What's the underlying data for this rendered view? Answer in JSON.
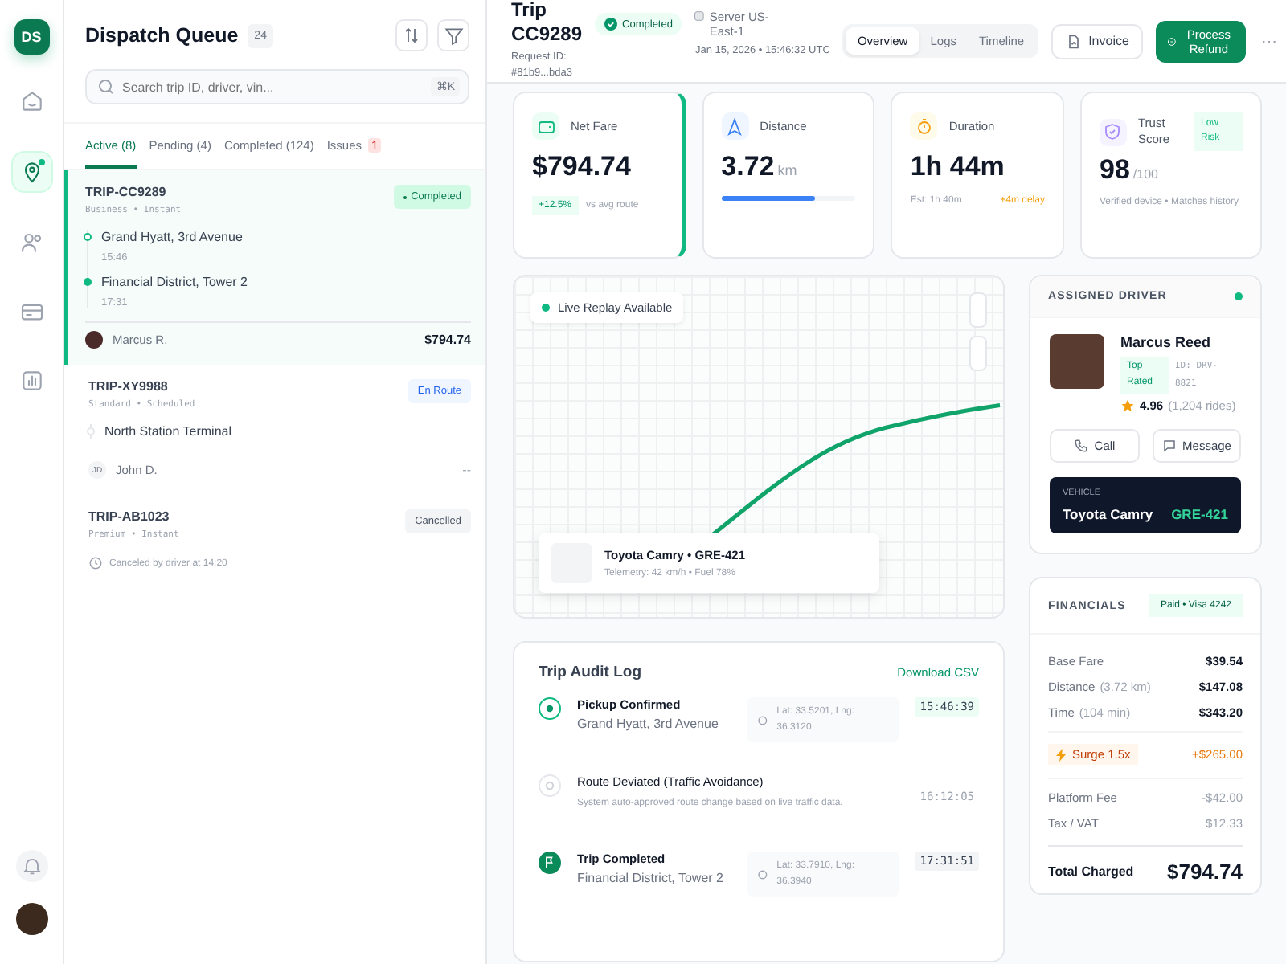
{
  "rail": {
    "logo": "DS",
    "items": [
      {
        "kind": "home",
        "selected": false
      },
      {
        "kind": "pin",
        "selected": true,
        "dot": true
      },
      {
        "kind": "users",
        "selected": false
      },
      {
        "kind": "card",
        "selected": false
      },
      {
        "kind": "chart",
        "selected": false
      }
    ]
  },
  "queue": {
    "title": "Dispatch Queue",
    "count": "24",
    "search": {
      "placeholder": "Search trip ID, driver, vin...",
      "shortcut": "⌘K"
    },
    "tabs": [
      {
        "label": "Active (8)",
        "selected": true
      },
      {
        "label": "Pending (4)",
        "selected": false
      },
      {
        "label": "Completed (124)",
        "selected": false
      },
      {
        "label": "Issues",
        "selected": false,
        "badge": "1"
      }
    ],
    "trips": [
      {
        "id": "TRIP-CC9289",
        "meta": "Business • Instant",
        "status": "Completed",
        "kind": "completed",
        "selected": true,
        "stops": [
          {
            "name": "Grand Hyatt, 3rd Avenue",
            "time": "15:46",
            "kind": "pickup"
          },
          {
            "name": "Financial District, Tower 2",
            "time": "17:31",
            "kind": "dropoff"
          }
        ],
        "driver": {
          "name": "Marcus R."
        },
        "fare": "$794.74"
      },
      {
        "id": "TRIP-XY9988",
        "meta": "Standard • Scheduled",
        "status": "En Route",
        "kind": "en_route",
        "selected": false,
        "stops": [
          {
            "name": "North Station Terminal",
            "kind": "pending"
          }
        ],
        "driver": {
          "name": "John D.",
          "initials": "JD"
        },
        "fare": "--"
      },
      {
        "id": "TRIP-AB1023",
        "meta": "Premium • Instant",
        "status": "Cancelled",
        "kind": "cancelled",
        "selected": false,
        "note": "Canceled by driver at 14:20"
      }
    ]
  },
  "header": {
    "title_prefix": "Trip",
    "title": "CC9289",
    "status": "Completed",
    "request_label": "Request ID:",
    "request_id": "#81b9...bda3",
    "server_label": "Server",
    "server": "US-East-1",
    "timestamp": "Jan 15, 2026 • 15:46:32 UTC",
    "view_tabs": [
      {
        "label": "Overview",
        "selected": true
      },
      {
        "label": "Logs",
        "selected": false
      },
      {
        "label": "Timeline",
        "selected": false
      }
    ],
    "invoice": "Invoice",
    "refund": "Process Refund",
    "more": "⋯"
  },
  "metrics": [
    {
      "kind": "fare",
      "label": "Net Fare",
      "value": "$794.74",
      "change": "+12.5%",
      "note": "vs avg route"
    },
    {
      "kind": "distance",
      "label": "Distance",
      "value": "3.72",
      "unit": "km",
      "level": 0.7
    },
    {
      "kind": "duration",
      "label": "Duration",
      "value": "1h 44m",
      "estimate": "Est: 1h 40m",
      "delay": "+4m delay"
    },
    {
      "kind": "trust",
      "label": "Trust Score",
      "badge": "Low Risk",
      "value": "98",
      "unit": "/100",
      "note": "Verified device • Matches history"
    }
  ],
  "map": {
    "badge": "Live Replay Available",
    "vehicle": "Toyota Camry • GRE-421",
    "telemetry": "Telemetry: 42 km/h • Fuel 78%"
  },
  "driver": {
    "heading": "ASSIGNED DRIVER",
    "online": true,
    "name": "Marcus Reed",
    "badge": "Top Rated",
    "id": "ID: DRV-8821",
    "rating": "4.96",
    "rides": "(1,204 rides)",
    "call": "Call",
    "message": "Message",
    "vehicle_label": "VEHICLE",
    "vehicle": "Toyota Camry",
    "plate": "GRE-421"
  },
  "audit": {
    "title": "Trip Audit Log",
    "download": "Download CSV",
    "events": [
      {
        "kind": "pickup",
        "title": "Pickup Confirmed",
        "detail": "Grand Hyatt, 3rd Avenue",
        "coords": "Lat: 33.5201, Lng: 36.3120",
        "time": "15:46:39"
      },
      {
        "kind": "deviation",
        "title": "Route Deviated (Traffic Avoidance)",
        "detail": "System auto-approved route change based on live traffic data.",
        "time": "16:12:05"
      },
      {
        "kind": "complete",
        "title": "Trip Completed",
        "detail": "Financial District, Tower 2",
        "coords": "Lat: 33.7910, Lng: 36.3940",
        "time": "17:31:51"
      }
    ]
  },
  "financials": {
    "heading": "FINANCIALS",
    "payment": "Paid • Visa 4242",
    "rows": [
      {
        "kind": "line",
        "label": "Base Fare",
        "amount": "$39.54"
      },
      {
        "kind": "line",
        "label": "Distance",
        "detail": "(3.72 km)",
        "amount": "$147.08"
      },
      {
        "kind": "line",
        "label": "Time",
        "detail": "(104 min)",
        "amount": "$343.20"
      },
      {
        "kind": "surge",
        "label": "Surge 1.5x",
        "amount": "+$265.00"
      },
      {
        "kind": "fee",
        "label": "Platform Fee",
        "amount": "-$42.00"
      },
      {
        "kind": "fee",
        "label": "Tax / VAT",
        "amount": "$12.33"
      }
    ],
    "total_label": "Total Charged",
    "total": "$794.74"
  }
}
